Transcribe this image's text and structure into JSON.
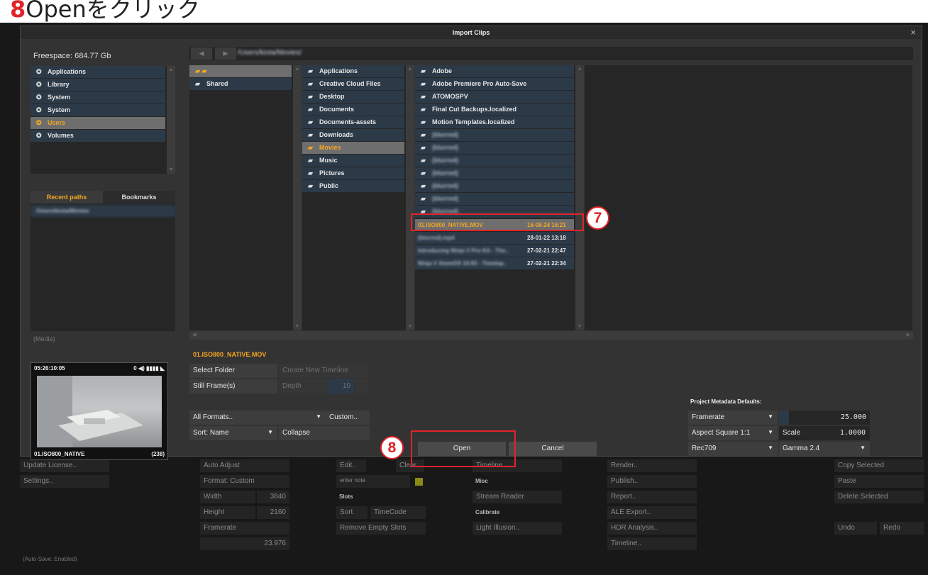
{
  "heading": {
    "num": "8",
    "text": "Openをクリック"
  },
  "dialog": {
    "title": "Import Clips",
    "close": "×",
    "freespace": "Freespace: 684.77 Gb",
    "path": "/Users/kiota/Movies/",
    "volumes": [
      "Applications",
      "Library",
      "System",
      "System",
      "Users",
      "Volumes"
    ],
    "tabs": {
      "recent": "Recent paths",
      "bookmarks": "Bookmarks"
    },
    "recent_path": "/Users/kiota/Movies",
    "media_label": "(Media)",
    "col1": [
      "Shared"
    ],
    "col2": [
      "Applications",
      "Creative Cloud Files",
      "Desktop",
      "Documents",
      "Documents-assets",
      "Downloads",
      "Movies",
      "Music",
      "Pictures",
      "Public"
    ],
    "col3": [
      "Adobe",
      "Adobe Premiere Pro Auto-Save",
      "ATOMOSPV",
      "Final Cut Backups.localized",
      "Motion Templates.localized",
      "(blurred)",
      "(blurred)",
      "(blurred)",
      "(blurred)",
      "(blurred)",
      "(blurred)",
      "(blurred)"
    ],
    "files": [
      {
        "name": "01.ISO800_NATIVE.MOV",
        "date": "16-08-24 16:21"
      },
      {
        "name": "(blurred).mp4",
        "date": "28-01-22 13:18"
      },
      {
        "name": "Introducing Ninja V Pro Kit - The..",
        "date": "27-02-21 22:47"
      },
      {
        "name": "Ninja V AtomOS 10.93 - Timelap..",
        "date": "27-02-21 22:34"
      }
    ],
    "selected_file": "01.ISO800_NATIVE.MOV",
    "preview": {
      "timecode": "05:26:10:05",
      "audio": "0 ◀) ▮▮▮▮ ◣",
      "name": "01.ISO800_NATIVE",
      "count": "(238)"
    },
    "buttons": {
      "select_folder": "Select Folder",
      "create_timeline": "Create New Timeline",
      "still_frames": "Still Frame(s)",
      "depth": "Depth",
      "depth_val": "10",
      "all_formats": "All Formats..",
      "custom": "Custom..",
      "sort": "Sort: Name",
      "collapse": "Collapse",
      "open": "Open",
      "cancel": "Cancel"
    },
    "metadata": {
      "title": "Project Metadata Defaults:",
      "framerate": "Framerate",
      "framerate_val": "25.000",
      "aspect": "Aspect Square 1:1",
      "scale": "Scale",
      "scale_val": "1.0000",
      "colorspace": "Rec709",
      "gamma": "Gamma 2.4"
    }
  },
  "annotations": {
    "seven": "7",
    "eight": "8"
  },
  "background": {
    "update": "Update License..",
    "settings": "Settings..",
    "autosave": "(Auto-Save: Enabled)",
    "auto_adjust": "Auto Adjust",
    "format": "Format: Custom",
    "width": "Width",
    "width_val": "3840",
    "height": "Height",
    "height_val": "2160",
    "framerate": "Framerate",
    "fps": "23.976",
    "edit": "Edit..",
    "clear": "Clear",
    "enter_note": "enter note",
    "slots": "Slots",
    "sort": "Sort",
    "timecode": "TimeCode",
    "remove": "Remove Empty Slots",
    "timeline": "Timeline",
    "misc": "Misc",
    "stream": "Stream Reader",
    "calibrate": "Calibrate",
    "light": "Light Illusion..",
    "render": "Render..",
    "publish": "Publish..",
    "report": "Report..",
    "ale": "ALE Export..",
    "hdr": "HDR Analysis..",
    "timeline2": "Timeline..",
    "copy": "Copy Selected",
    "paste": "Paste",
    "delete": "Delete Selected",
    "undo": "Undo",
    "redo": "Redo"
  }
}
